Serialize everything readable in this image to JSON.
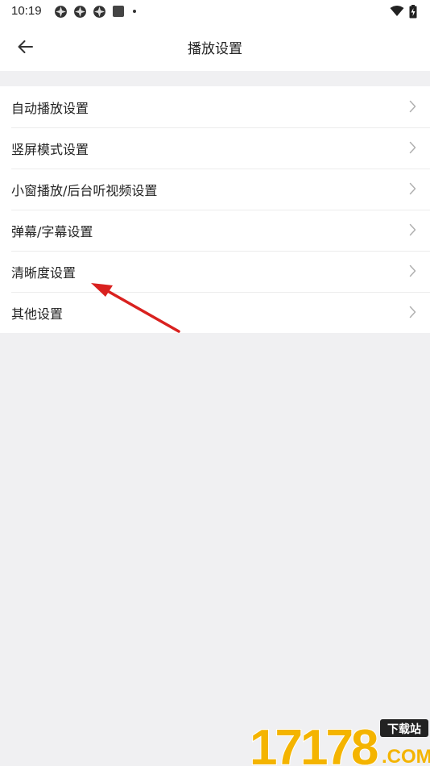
{
  "status_bar": {
    "time": "10:19",
    "left_icons": [
      "app-notification-icon",
      "app-notification-icon",
      "app-notification-icon",
      "square-notification-icon",
      "dot-icon"
    ],
    "right_icons": [
      "wifi-icon",
      "battery-charging-icon"
    ]
  },
  "app_bar": {
    "title": "播放设置",
    "back_icon": "arrow-left-icon"
  },
  "settings": {
    "items": [
      {
        "label": "自动播放设置",
        "icon": "chevron-right-icon"
      },
      {
        "label": "竖屏模式设置",
        "icon": "chevron-right-icon"
      },
      {
        "label": "小窗播放/后台听视频设置",
        "icon": "chevron-right-icon"
      },
      {
        "label": "弹幕/字幕设置",
        "icon": "chevron-right-icon"
      },
      {
        "label": "清晰度设置",
        "icon": "chevron-right-icon"
      },
      {
        "label": "其他设置",
        "icon": "chevron-right-icon"
      }
    ]
  },
  "annotation": {
    "color": "#d9211f",
    "points_to": "清晰度设置"
  },
  "watermark": {
    "text": "17178",
    "badge_text": "下载站",
    "sub_text": ".COM",
    "colors": {
      "main": "#f4b400",
      "badge": "#222222"
    }
  },
  "colors": {
    "background": "#f0f0f2",
    "surface": "#ffffff",
    "text": "#222222",
    "chevron": "#b0b0b0",
    "divider": "#ececec"
  }
}
